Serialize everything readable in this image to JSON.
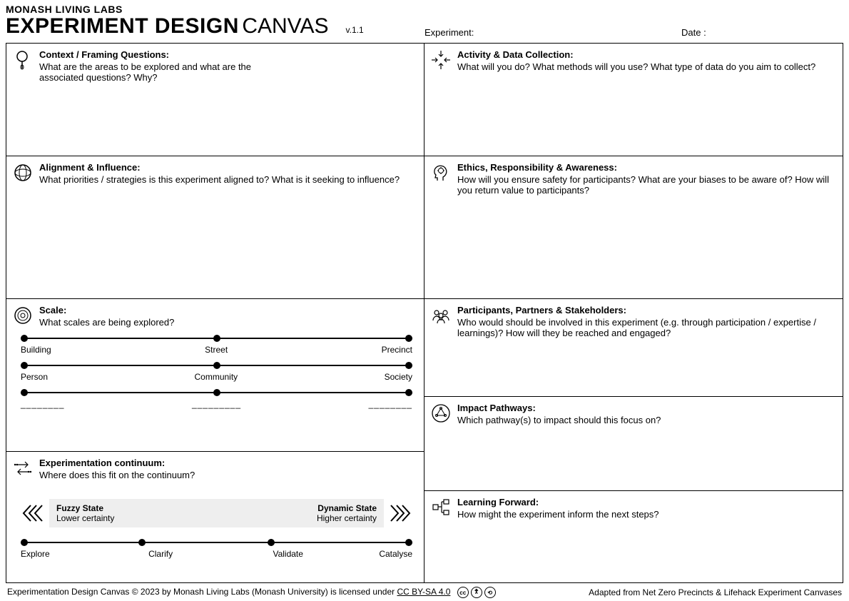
{
  "header": {
    "brand": "MONASH LIVING LABS",
    "title_bold": "EXPERIMENT DESIGN",
    "title_light": "CANVAS",
    "version": "v.1.1",
    "experiment_label": "Experiment:",
    "date_label": "Date :"
  },
  "left": {
    "context": {
      "title": "Context / Framing Questions:",
      "sub": "What are the areas to be explored and what are the associated questions? Why?"
    },
    "alignment": {
      "title": "Alignment & Influence:",
      "sub": "What priorities / strategies is this experiment aligned to? What is it seeking to influence?"
    },
    "scale": {
      "title": "Scale:",
      "sub": "What scales are being explored?",
      "row1": {
        "l": "Building",
        "m": "Street",
        "r": "Precinct"
      },
      "row2": {
        "l": "Person",
        "m": "Community",
        "r": "Society"
      },
      "row3": {
        "l": "________",
        "m": "_________",
        "r": "________"
      }
    },
    "continuum": {
      "title": "Experimentation continuum:",
      "sub": "Where does this fit on the continuum?",
      "fuzzy_title": "Fuzzy State",
      "fuzzy_sub": "Lower certainty",
      "dyn_title": "Dynamic State",
      "dyn_sub": "Higher certainty",
      "stops": {
        "a": "Explore",
        "b": "Clarify",
        "c": "Validate",
        "d": "Catalyse"
      }
    }
  },
  "right": {
    "activity": {
      "title": "Activity & Data Collection:",
      "sub": "What will you do? What methods will you use? What type of data do you aim to collect?"
    },
    "ethics": {
      "title": "Ethics, Responsibility & Awareness:",
      "sub": "How will you ensure safety for participants? What are your biases to be aware of? How will you return value to participants?"
    },
    "participants": {
      "title": "Participants, Partners & Stakeholders:",
      "sub": "Who would should be involved in this experiment (e.g. through participation / expertise / learnings)? How will they be reached and engaged?"
    },
    "impact": {
      "title": "Impact Pathways:",
      "sub": "Which pathway(s) to impact should this focus on?"
    },
    "learning": {
      "title": "Learning Forward:",
      "sub": "How might the experiment inform the next steps?"
    }
  },
  "footer": {
    "left": "Experimentation Design Canvas © 2023 by Monash Living Labs (Monash University) is licensed under ",
    "license": "CC BY-SA 4.0",
    "right": "Adapted from Net Zero Precincts & Lifehack Experiment Canvases",
    "cc": "cc",
    "by": "b",
    "sa": "s"
  }
}
